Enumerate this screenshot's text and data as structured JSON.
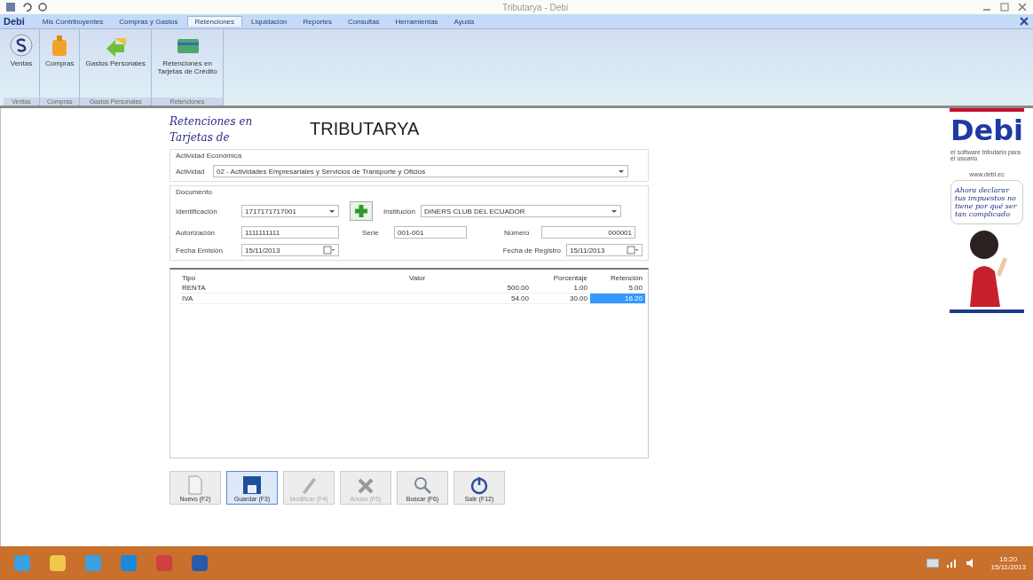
{
  "window": {
    "title": "Tributarya - Debi",
    "app_badge": "Debi"
  },
  "ribbon_tabs": [
    {
      "label": "Mis Contribuyentes",
      "selected": false
    },
    {
      "label": "Compras y Gastos",
      "selected": false
    },
    {
      "label": "Retenciones",
      "selected": true
    },
    {
      "label": "Liquidación",
      "selected": false
    },
    {
      "label": "Reportes",
      "selected": false
    },
    {
      "label": "Consultas",
      "selected": false
    },
    {
      "label": "Herramientas",
      "selected": false
    },
    {
      "label": "Ayuda",
      "selected": false
    }
  ],
  "ribbon_groups": [
    {
      "label": "Ventas",
      "buttons": [
        {
          "label": "Ventas"
        }
      ]
    },
    {
      "label": "Compras",
      "buttons": [
        {
          "label": "Compras"
        }
      ]
    },
    {
      "label": "Gastos Personales",
      "buttons": [
        {
          "label": "Gastos Personales"
        }
      ]
    },
    {
      "label": "Retenciones",
      "buttons": [
        {
          "label": "Retenciones en Tarjetas de Crédito"
        }
      ]
    }
  ],
  "form": {
    "script_title": "Retenciones en Tarjetas de",
    "brand": "TRIBUTARYA",
    "activity_group": {
      "legend": "Actividad Económica",
      "label": "Actividad",
      "value": "02 - Actividades Empresariales y Servicios de Transporte y Oficios"
    },
    "document_group": {
      "legend": "Documento",
      "identificacion": {
        "label": "Identificación",
        "value": "1717171717001"
      },
      "institucion": {
        "label": "Institución",
        "value": "DINERS CLUB DEL ECUADOR"
      },
      "autorizacion": {
        "label": "Autorización",
        "value": "1111111111"
      },
      "serie": {
        "label": "Serie",
        "value": "001-001"
      },
      "numero": {
        "label": "Número",
        "value": "000001"
      },
      "fecha_emision": {
        "label": "Fecha Emisión",
        "value": "15/11/2013"
      },
      "fecha_registro": {
        "label": "Fecha de Registro",
        "value": "15/11/2013"
      }
    },
    "table": {
      "columns": [
        "Tipo",
        "Valor",
        "Porcentaje",
        "Retención"
      ],
      "rows": [
        {
          "cells": [
            {
              "text": "RENTA",
              "selected": false
            },
            {
              "text": "500.00",
              "selected": false
            },
            {
              "text": "1.00",
              "selected": false
            },
            {
              "text": "5.00",
              "selected": false
            }
          ]
        },
        {
          "cells": [
            {
              "text": "IVA",
              "selected": false
            },
            {
              "text": "54.00",
              "selected": false
            },
            {
              "text": "30.00",
              "selected": false
            },
            {
              "text": "16.20",
              "selected": true
            }
          ]
        }
      ]
    },
    "buttons": [
      {
        "label": "Nuevo (F2)",
        "disabled": false,
        "focused": false
      },
      {
        "label": "Guardar (F3)",
        "disabled": false,
        "focused": true
      },
      {
        "label": "Modificar (F4)",
        "disabled": true,
        "focused": false
      },
      {
        "label": "Anular (F5)",
        "disabled": true,
        "focused": false
      },
      {
        "label": "Buscar (F6)",
        "disabled": false,
        "focused": false
      },
      {
        "label": "Salir (F12)",
        "disabled": false,
        "focused": false
      }
    ]
  },
  "ad": {
    "logo": "Debi",
    "tagline": "el software tributario para el usuario",
    "url": "www.debi.ec",
    "speech": "Ahora declarar tus impuestos no tiene por qué ser tan complicado"
  },
  "taskbar": {
    "time": "16:20",
    "date": "15/11/2013"
  }
}
